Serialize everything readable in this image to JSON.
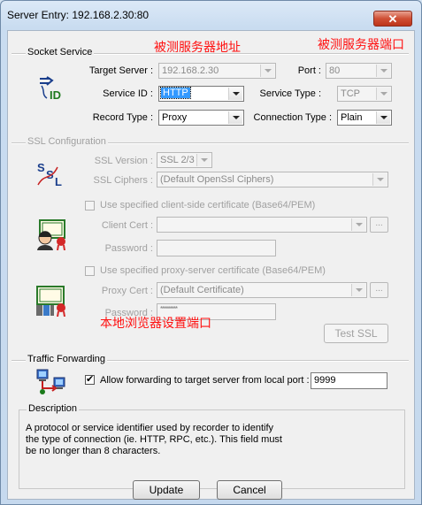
{
  "window": {
    "title": "Server Entry: 192.168.2.30:80",
    "close_glyph": "✕"
  },
  "socket_service": {
    "group_label": "Socket Service",
    "icon": "entry-id-icon",
    "target_server": {
      "label": "Target Server :",
      "value": "192.168.2.30"
    },
    "port": {
      "label": "Port :",
      "value": "80"
    },
    "service_id": {
      "label": "Service ID :",
      "value": "HTTP"
    },
    "service_type": {
      "label": "Service Type :",
      "value": "TCP"
    },
    "record_type": {
      "label": "Record Type :",
      "value": "Proxy"
    },
    "connection_type": {
      "label": "Connection Type :",
      "value": "Plain"
    }
  },
  "ssl": {
    "group_label": "SSL Configuration",
    "icon": "ssl-icon",
    "version": {
      "label": "SSL Version :",
      "value": "SSL 2/3"
    },
    "ciphers": {
      "label": "SSL Ciphers :",
      "value": "(Default OpenSsl Ciphers)"
    },
    "client_cert_check": "Use specified client-side certificate (Base64/PEM)",
    "client_cert": {
      "label": "Client Cert :",
      "value": ""
    },
    "client_password": {
      "label": "Password :",
      "value": ""
    },
    "proxy_cert_check": "Use specified proxy-server certificate (Base64/PEM)",
    "proxy_cert": {
      "label": "Proxy Cert :",
      "value": "(Default Certificate)"
    },
    "proxy_password": {
      "label": "Password :",
      "value": "*********"
    },
    "browse_label": "...",
    "test_ssl_label": "Test SSL"
  },
  "traffic": {
    "group_label": "Traffic Forwarding",
    "icon": "network-forward-icon",
    "forward_label": "Allow forwarding to target server from local port :",
    "forward_checked": true,
    "local_port": "9999"
  },
  "description": {
    "label": "Description",
    "lines": [
      "A protocol or service identifier used by recorder to identify",
      "the type of connection (ie. HTTP, RPC, etc.).  This field must",
      "be no longer than 8 characters."
    ]
  },
  "buttons": {
    "update": "Update",
    "cancel": "Cancel"
  },
  "annotations": {
    "target_server": "被测服务器地址",
    "target_port": "被测服务器端口",
    "local_port": "本地浏览器设置端口"
  },
  "colors": {
    "annotation": "#ff1010",
    "selection": "#3399ff"
  }
}
